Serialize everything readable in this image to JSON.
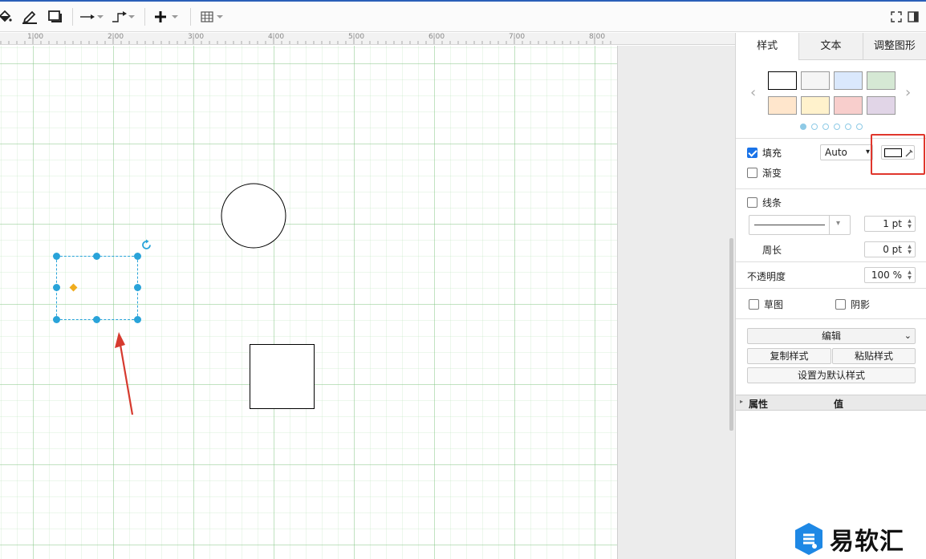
{
  "toolbar": {
    "icons": [
      "fill-color-icon",
      "line-color-icon",
      "shadow-icon",
      "connector-icon",
      "waypoint-icon",
      "insert-icon",
      "table-icon",
      "fullscreen-icon",
      "toggle-panel-icon"
    ]
  },
  "ruler": {
    "labels": [
      "1.00",
      "2.00",
      "3.00",
      "4.00",
      "5.00",
      "6.00",
      "7.00",
      "8.00"
    ]
  },
  "panel": {
    "tabs": [
      {
        "label": "样式",
        "active": true
      },
      {
        "label": "文本",
        "active": false
      },
      {
        "label": "调整图形",
        "active": false
      }
    ],
    "swatches": [
      "#ffffff",
      "#f5f5f5",
      "#dae8fc",
      "#d5e8d4",
      "#ffe6cc",
      "#fff2cc",
      "#f8cecc",
      "#e1d5e7"
    ],
    "swatch_pages": 6,
    "swatch_page_active": 0,
    "fill": {
      "label": "填充",
      "checked": true,
      "mode": "Auto"
    },
    "gradient": {
      "label": "渐变",
      "checked": false
    },
    "line": {
      "label": "线条",
      "checked": false,
      "width": "1 pt"
    },
    "perimeter": {
      "label": "周长",
      "value": "0 pt"
    },
    "opacity": {
      "label": "不透明度",
      "value": "100 %"
    },
    "sketch": {
      "label": "草图",
      "checked": false
    },
    "shadow": {
      "label": "阴影",
      "checked": false
    },
    "edit_label": "编辑",
    "copy_style": "复制样式",
    "paste_style": "粘贴样式",
    "set_default": "设置为默认样式",
    "properties": {
      "col1": "属性",
      "col2": "值"
    }
  },
  "watermark": {
    "text": "易软汇"
  },
  "colors": {
    "accent": "#29a3d9",
    "highlight": "#e0362c",
    "handle_diamond": "#f0ad1e"
  }
}
